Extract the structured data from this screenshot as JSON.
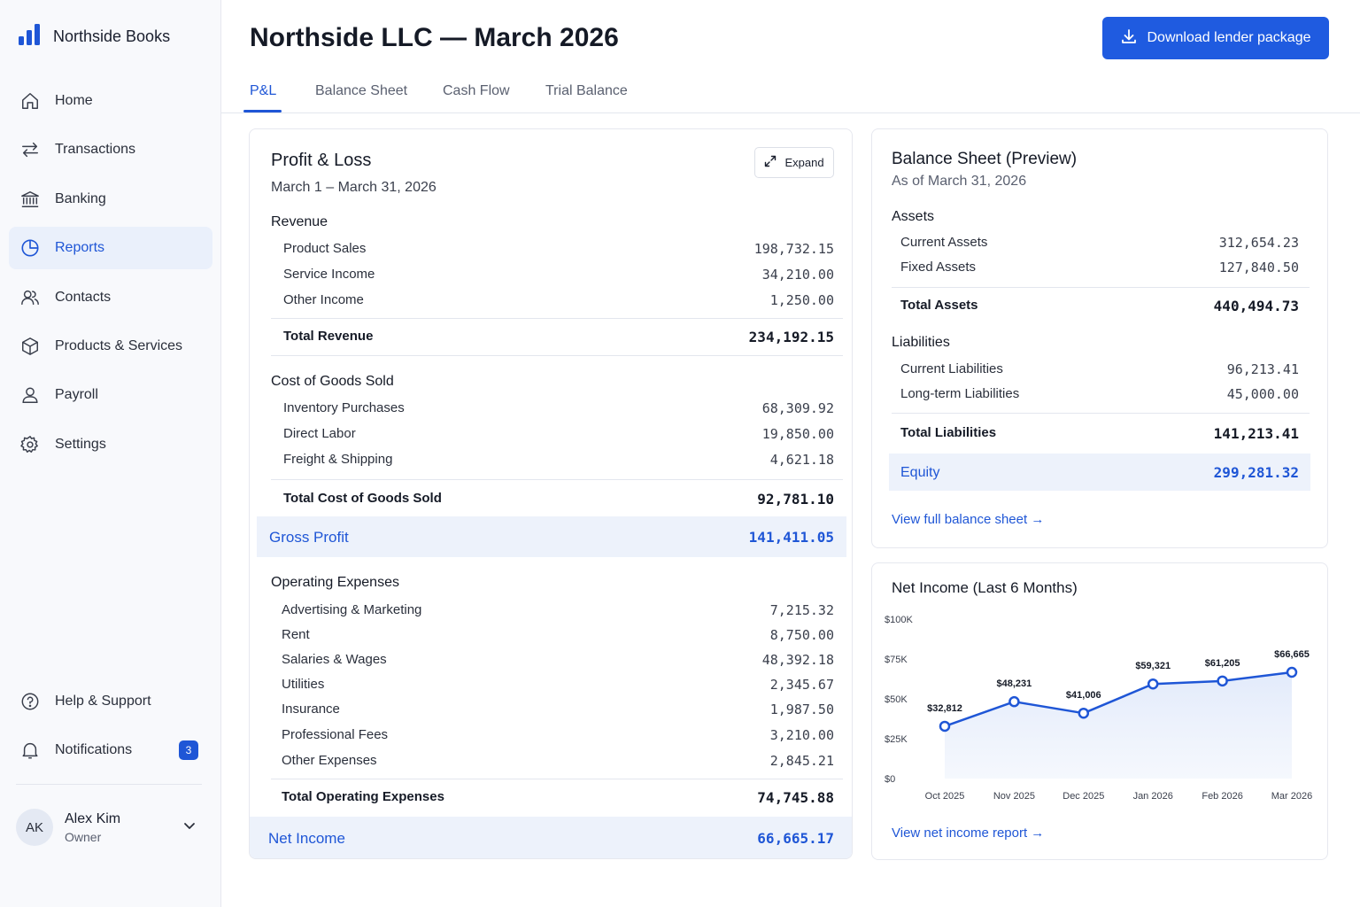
{
  "brand": {
    "name": "Northside Books",
    "logo_icon": "bar-chart-logo-icon"
  },
  "nav": {
    "items": [
      {
        "label": "Home",
        "icon": "home-icon"
      },
      {
        "label": "Transactions",
        "icon": "arrows-icon"
      },
      {
        "label": "Banking",
        "icon": "bank-icon"
      },
      {
        "label": "Reports",
        "icon": "pie-chart-icon",
        "active": true
      },
      {
        "label": "Contacts",
        "icon": "users-icon"
      },
      {
        "label": "Products & Services",
        "icon": "box-icon"
      },
      {
        "label": "Payroll",
        "icon": "person-icon"
      },
      {
        "label": "Settings",
        "icon": "gear-icon"
      }
    ],
    "bottom": [
      {
        "label": "Help & Support",
        "icon": "help-icon"
      },
      {
        "label": "Notifications",
        "icon": "bell-icon",
        "badge": "3"
      }
    ]
  },
  "user": {
    "initials": "AK",
    "name": "Alex Kim",
    "role": "Owner"
  },
  "header": {
    "title": "Northside LLC — March 2026",
    "download_label": "Download lender package"
  },
  "tabs": [
    "P&L",
    "Balance Sheet",
    "Cash Flow",
    "Trial Balance"
  ],
  "pl": {
    "title": "Profit & Loss",
    "period": "March 1 – March 31, 2026",
    "expand_label": "Expand",
    "revenue": {
      "heading": "Revenue",
      "rows": [
        {
          "label": "Product Sales",
          "value": "198,732.15"
        },
        {
          "label": "Service Income",
          "value": "34,210.00"
        },
        {
          "label": "Other Income",
          "value": "1,250.00"
        }
      ],
      "total_label": "Total Revenue",
      "total_value": "234,192.15"
    },
    "cogs": {
      "heading": "Cost of Goods Sold",
      "rows": [
        {
          "label": "Inventory Purchases",
          "value": "68,309.92"
        },
        {
          "label": "Direct Labor",
          "value": "19,850.00"
        },
        {
          "label": "Freight & Shipping",
          "value": "4,621.18"
        }
      ],
      "total_label": "Total Cost of Goods Sold",
      "total_value": "92,781.10"
    },
    "gross_profit": {
      "label": "Gross Profit",
      "value": "141,411.05"
    },
    "opex": {
      "heading": "Operating Expenses",
      "rows": [
        {
          "label": "Advertising & Marketing",
          "value": "7,215.32"
        },
        {
          "label": "Rent",
          "value": "8,750.00"
        },
        {
          "label": "Salaries & Wages",
          "value": "48,392.18"
        },
        {
          "label": "Utilities",
          "value": "2,345.67"
        },
        {
          "label": "Insurance",
          "value": "1,987.50"
        },
        {
          "label": "Professional Fees",
          "value": "3,210.00"
        },
        {
          "label": "Other Expenses",
          "value": "2,845.21"
        }
      ],
      "total_label": "Total Operating Expenses",
      "total_value": "74,745.88"
    },
    "net_income": {
      "label": "Net Income",
      "value": "66,665.17"
    }
  },
  "balance_sheet": {
    "title": "Balance Sheet (Preview)",
    "as_of": "As of March 31, 2026",
    "assets": {
      "heading": "Assets",
      "rows": [
        {
          "label": "Current Assets",
          "value": "312,654.23"
        },
        {
          "label": "Fixed Assets",
          "value": "127,840.50"
        }
      ],
      "total_label": "Total Assets",
      "total_value": "440,494.73"
    },
    "liabilities": {
      "heading": "Liabilities",
      "rows": [
        {
          "label": "Current Liabilities",
          "value": "96,213.41"
        },
        {
          "label": "Long-term Liabilities",
          "value": "45,000.00"
        }
      ],
      "total_label": "Total Liabilities",
      "total_value": "141,213.41"
    },
    "equity": {
      "label": "Equity",
      "value": "299,281.32"
    },
    "link": "View full balance sheet →"
  },
  "net_income_card": {
    "title": "Net Income (Last 6 Months)",
    "link": "View net income report →"
  },
  "colors": {
    "accent": "#1f56d6",
    "highlight_bg": "#edf2fb",
    "sidebar_bg": "#f8f9fc"
  },
  "chart_data": {
    "type": "line",
    "x": [
      "Oct 2025",
      "Nov 2025",
      "Dec 2025",
      "Jan 2026",
      "Feb 2026",
      "Mar 2026"
    ],
    "values": [
      32812,
      48231,
      41006,
      59321,
      61205,
      66665
    ],
    "data_labels": [
      "$32,812",
      "$48,231",
      "$41,006",
      "$59,321",
      "$61,205",
      "$66,665"
    ],
    "yticks": [
      0,
      25000,
      50000,
      75000,
      100000
    ],
    "ytick_labels": [
      "$0",
      "$25K",
      "$50K",
      "$75K",
      "$100K"
    ],
    "ylim": [
      0,
      100000
    ],
    "grid": false,
    "area_fill": true
  }
}
